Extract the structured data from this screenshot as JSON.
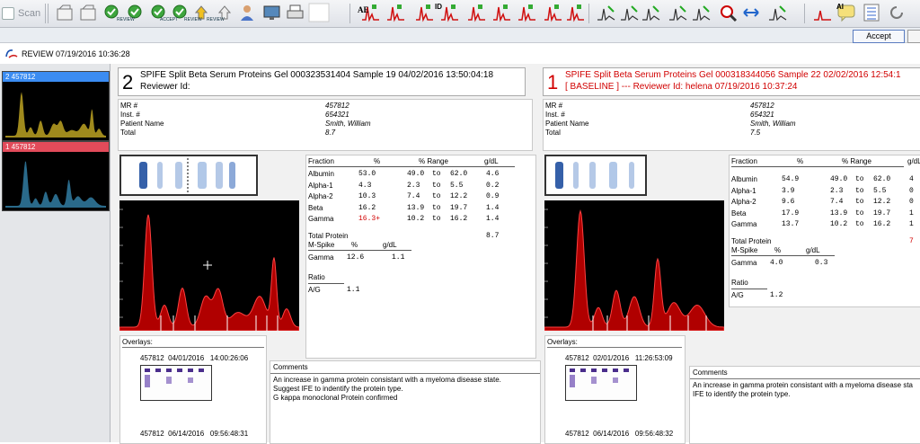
{
  "toolbar": {
    "scan_label": "Scan",
    "small_labels": [
      "REVIEW",
      "ACCEPT",
      "REVIEW",
      "REVIEW"
    ],
    "ae_label": "AE",
    "id_label": "ID",
    "ai_label": "AI",
    "icons": [
      "scan-icon",
      "folder-icon",
      "edit-icon",
      "reviewe-icon",
      "review-icon",
      "accept-icon",
      "recent-icon",
      "upload-icon",
      "download-icon",
      "user-icon",
      "monitor-icon",
      "print-icon",
      "ae-icon",
      "peak-icon",
      "peak-icon",
      "id-icon",
      "peak-icon",
      "peak-icon",
      "peak-icon",
      "peak-icon",
      "peak-icon",
      "peak-icon",
      "chart-icon",
      "chart-icon",
      "chart-icon",
      "chart-icon",
      "chart-icon",
      "zoom-icon",
      "arrows-icon",
      "chart-icon",
      "ai-icon",
      "chat-icon",
      "notes-icon",
      "refresh-icon"
    ]
  },
  "accept_label": "Accept",
  "window": {
    "title": "REVIEW",
    "datetime": "07/19/2016  10:36:28"
  },
  "thumbs": [
    {
      "label": "2  457812",
      "color": "#3b8cf2",
      "fill": "#a08a1d"
    },
    {
      "label": "1  457812",
      "color": "#e24b5a",
      "fill": "#2a6a8a"
    }
  ],
  "left_panel": {
    "number": "2",
    "title": "SPIFE Split Beta Serum Proteins  Gel 000323531404  Sample 19  04/02/2016  13:50:04:18",
    "subtitle": "Reviewer Id:",
    "info_labels": [
      "MR #",
      "Inst. #",
      "Patient Name",
      "Total"
    ],
    "info_values": [
      "457812",
      "654321",
      "Smith, William",
      "8.7"
    ],
    "fractions_header": [
      "Fraction",
      "%",
      "% Range",
      "g/dL"
    ],
    "fractions": [
      {
        "name": "Albumin",
        "pct": "53.0",
        "low": "49.0",
        "to": "to",
        "high": "62.0",
        "gdl": "4.6",
        "flag": false
      },
      {
        "name": "Alpha-1",
        "pct": "4.3",
        "low": "2.3",
        "to": "to",
        "high": "5.5",
        "gdl": "0.2",
        "flag": false
      },
      {
        "name": "Alpha-2",
        "pct": "10.3",
        "low": "7.4",
        "to": "to",
        "high": "12.2",
        "gdl": "0.9",
        "flag": false
      },
      {
        "name": "Beta",
        "pct": "16.2",
        "low": "13.9",
        "to": "to",
        "high": "19.7",
        "gdl": "1.4",
        "flag": false
      },
      {
        "name": "Gamma",
        "pct": "16.3+",
        "low": "10.2",
        "to": "to",
        "high": "16.2",
        "gdl": "1.4",
        "flag": true
      }
    ],
    "total_protein_label": "Total Protein",
    "total_protein": "8.7",
    "mspike_header": [
      "M-Spike",
      "%",
      "g/dL"
    ],
    "mspike": {
      "name": "Gamma",
      "pct": "12.6",
      "gdl": "1.1"
    },
    "ratio_label": "Ratio",
    "ratio": {
      "name": "A/G",
      "value": "1.1"
    },
    "overlays_label": "Overlays:",
    "overlays": [
      {
        "id": "457812",
        "date": "04/01/2016",
        "time": "14:00:26:06"
      },
      {
        "id": "457812",
        "date": "06/14/2016",
        "time": "09:56:48:31"
      }
    ],
    "comments_label": "Comments",
    "comments": [
      "An increase in gamma protein consistant with a myeloma disease state.",
      "Suggest IFE to indentify the protein type.",
      "G kappa monoclonal Protein confirmed"
    ]
  },
  "right_panel": {
    "number": "1",
    "title": "SPIFE Split Beta Serum Proteins  Gel 000318344056  Sample 22  02/02/2016  12:54:1",
    "subtitle": "[ BASELINE ]  ---  Reviewer Id: helena  07/19/2016  10:37:24",
    "info_labels": [
      "MR #",
      "Inst. #",
      "Patient Name",
      "Total"
    ],
    "info_values": [
      "457812",
      "654321",
      "Smith, William",
      "7.5"
    ],
    "fractions_header": [
      "Fraction",
      "%",
      "% Range",
      "g/dL"
    ],
    "fractions": [
      {
        "name": "Albumin",
        "pct": "54.9",
        "low": "49.0",
        "to": "to",
        "high": "62.0",
        "gdl": "4"
      },
      {
        "name": "Alpha-1",
        "pct": "3.9",
        "low": "2.3",
        "to": "to",
        "high": "5.5",
        "gdl": "0"
      },
      {
        "name": "Alpha-2",
        "pct": "9.6",
        "low": "7.4",
        "to": "to",
        "high": "12.2",
        "gdl": "0"
      },
      {
        "name": "Beta",
        "pct": "17.9",
        "low": "13.9",
        "to": "to",
        "high": "19.7",
        "gdl": "1"
      },
      {
        "name": "Gamma",
        "pct": "13.7",
        "low": "10.2",
        "to": "to",
        "high": "16.2",
        "gdl": "1"
      }
    ],
    "total_protein_label": "Total Protein",
    "total_protein": "7",
    "mspike_header": [
      "M-Spike",
      "%",
      "g/dL"
    ],
    "mspike": {
      "name": "Gamma",
      "pct": "4.0",
      "gdl": "0.3"
    },
    "ratio_label": "Ratio",
    "ratio": {
      "name": "A/G",
      "value": "1.2"
    },
    "overlays_label": "Overlays:",
    "overlays": [
      {
        "id": "457812",
        "date": "02/01/2016",
        "time": "11:26:53:09"
      },
      {
        "id": "457812",
        "date": "06/14/2016",
        "time": "09:56:48:32"
      }
    ],
    "comments_label": "Comments",
    "comments": [
      "An increase in gamma protein consistant with a myeloma disease sta",
      "IFE to identify the protein type."
    ]
  },
  "colors": {
    "accent": "#3b8cf2",
    "alert": "#d10000",
    "trace": "#b00000",
    "thumb_selected": "#3b8cf2",
    "thumb_baseline": "#e24b5a"
  }
}
